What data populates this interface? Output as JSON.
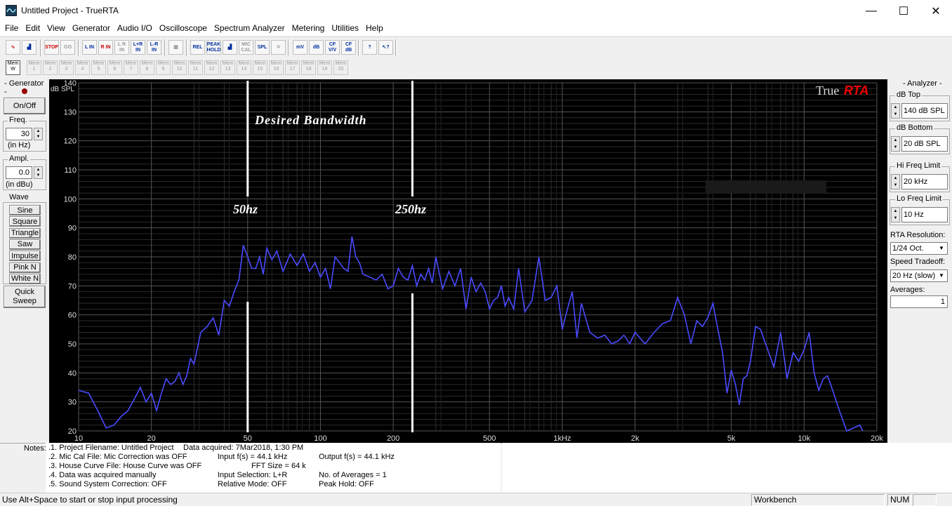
{
  "window": {
    "title": "Untitled Project - TrueRTA",
    "minimize_glyph": "—",
    "maximize_glyph": "☐",
    "close_glyph": "✕"
  },
  "menu": [
    "File",
    "Edit",
    "View",
    "Generator",
    "Audio I/O",
    "Oscilloscope",
    "Spectrum Analyzer",
    "Metering",
    "Utilities",
    "Help"
  ],
  "toolbar": {
    "buttons": [
      {
        "name": "sine-wave-icon",
        "label": "∿",
        "cls": "red"
      },
      {
        "name": "spectrum-bars-icon",
        "label": "▟",
        "cls": "blue"
      },
      {
        "name": "stop-icon",
        "label": "STOP",
        "cls": "red"
      },
      {
        "name": "go-icon",
        "label": "GO",
        "cls": "grey"
      },
      {
        "name": "left-in-button",
        "label": "L IN",
        "cls": "blue"
      },
      {
        "name": "right-in-button",
        "label": "R IN",
        "cls": "red"
      },
      {
        "name": "l-r-in-button",
        "label": "L R IN",
        "cls": "grey"
      },
      {
        "name": "l-plus-r-in-button",
        "label": "L+R IN",
        "cls": "blue"
      },
      {
        "name": "l-minus-r-in-button",
        "label": "L-R IN",
        "cls": "blue"
      },
      {
        "name": "grid-icon",
        "label": "▦",
        "cls": "grey"
      },
      {
        "name": "rel-button",
        "label": "REL",
        "cls": "blue"
      },
      {
        "name": "peak-hold-button",
        "label": "PEAK HOLD",
        "cls": "blue"
      },
      {
        "name": "spectrum-bar-icon",
        "label": "▟",
        "cls": "blue"
      },
      {
        "name": "mic-cal-button",
        "label": "MIC CAL",
        "cls": "grey"
      },
      {
        "name": "spl-button",
        "label": "SPL",
        "cls": "blue"
      },
      {
        "name": "cancel-x-icon",
        "label": "✕",
        "cls": "grey"
      },
      {
        "name": "mv-button",
        "label": "mV",
        "cls": "blue"
      },
      {
        "name": "db-button",
        "label": "dB",
        "cls": "blue"
      },
      {
        "name": "cf-vv-button",
        "label": "CF V/V",
        "cls": "blue"
      },
      {
        "name": "cf-db-button",
        "label": "CF dB",
        "cls": "blue"
      },
      {
        "name": "help-icon",
        "label": "?",
        "cls": "blue"
      },
      {
        "name": "context-help-icon",
        "label": "↖?",
        "cls": "blue"
      }
    ],
    "mem_prefix": "Mem",
    "mem_active_suffix": "W",
    "mem_slots": [
      "1",
      "2",
      "3",
      "4",
      "5",
      "6",
      "7",
      "8",
      "9",
      "10",
      "11",
      "12",
      "13",
      "14",
      "15",
      "16",
      "17",
      "18",
      "19",
      "20"
    ]
  },
  "generator": {
    "title": "- Generator -",
    "on_off": "On/Off",
    "freq_label": "Freq.",
    "freq_value": "30",
    "freq_unit": "(in Hz)",
    "ampl_label": "Ampl.",
    "ampl_value": "0.0",
    "ampl_unit": "(in dBu)",
    "wave_label": "Wave",
    "waves": [
      "Sine",
      "Square",
      "Triangle",
      "Saw",
      "Impulse",
      "Pink N",
      "White N"
    ],
    "quick_sweep_1": "Quick",
    "quick_sweep_2": "Sweep"
  },
  "analyzer": {
    "title": "- Analyzer -",
    "db_top_label": "dB Top",
    "db_top_value": "140 dB SPL",
    "db_bottom_label": "dB Bottom",
    "db_bottom_value": "20 dB SPL",
    "hi_freq_label": "Hi Freq Limit",
    "hi_freq_value": "20 kHz",
    "lo_freq_label": "Lo Freq Limit",
    "lo_freq_value": "10 Hz",
    "rta_res_label": "RTA Resolution:",
    "rta_res_value": "1/24 Oct.",
    "speed_label": "Speed Tradeoff:",
    "speed_value": "20 Hz (slow)",
    "averages_label": "Averages:",
    "averages_value": "1"
  },
  "graph": {
    "ylabel": "dB SPL",
    "logo_true": "True",
    "logo_rta": "RTA",
    "annotation_title": "Desired Bandwidth",
    "marker_50": "50hz",
    "marker_250": "250hz",
    "y_ticks": [
      "140",
      "130",
      "120",
      "110",
      "100",
      "90",
      "80",
      "70",
      "60",
      "50",
      "40",
      "30",
      "20"
    ],
    "x_ticks": [
      {
        "f": 10,
        "label": "10"
      },
      {
        "f": 20,
        "label": "20"
      },
      {
        "f": 50,
        "label": "50"
      },
      {
        "f": 100,
        "label": "100"
      },
      {
        "f": 200,
        "label": "200"
      },
      {
        "f": 500,
        "label": "500"
      },
      {
        "f": 1000,
        "label": "1kHz"
      },
      {
        "f": 2000,
        "label": "2k"
      },
      {
        "f": 5000,
        "label": "5k"
      },
      {
        "f": 10000,
        "label": "10k"
      },
      {
        "f": 20000,
        "label": "20k"
      }
    ],
    "line_color": "#4a4aff",
    "marker_freqs": [
      50,
      240
    ]
  },
  "chart_data": {
    "type": "line",
    "title": "",
    "xlabel": "",
    "ylabel": "dB SPL",
    "x_scale": "log",
    "xlim": [
      10,
      20000
    ],
    "ylim": [
      20,
      140
    ],
    "series": [
      {
        "x": [
          10,
          11,
          12,
          13,
          14,
          15,
          16,
          17,
          18,
          19,
          20,
          21,
          22,
          23,
          24,
          25,
          26,
          27,
          28,
          29,
          30,
          32,
          34,
          36,
          38,
          40,
          42,
          44,
          46,
          48,
          50,
          52,
          54,
          56,
          58,
          60,
          63,
          66,
          70,
          75,
          80,
          85,
          90,
          95,
          100,
          105,
          110,
          115,
          120,
          125,
          130,
          135,
          140,
          145,
          150,
          160,
          170,
          180,
          190,
          200,
          210,
          220,
          230,
          240,
          250,
          260,
          270,
          280,
          290,
          300,
          320,
          340,
          360,
          380,
          400,
          420,
          440,
          460,
          480,
          500,
          520,
          540,
          560,
          580,
          600,
          630,
          660,
          700,
          750,
          800,
          850,
          900,
          950,
          1000,
          1050,
          1100,
          1150,
          1200,
          1300,
          1400,
          1500,
          1600,
          1700,
          1800,
          1900,
          2000,
          2200,
          2400,
          2600,
          2800,
          3000,
          3200,
          3400,
          3600,
          3800,
          4000,
          4200,
          4400,
          4600,
          4800,
          5000,
          5200,
          5400,
          5600,
          5800,
          6000,
          6300,
          6600,
          7000,
          7500,
          8000,
          8500,
          9000,
          9500,
          10000,
          10500,
          11000,
          11500,
          12000,
          12500,
          13000,
          14000,
          15000,
          16000,
          17000,
          17500
        ],
        "y": [
          34,
          33,
          27,
          21,
          22,
          25,
          27,
          31,
          35,
          30,
          33,
          27,
          33,
          38,
          36,
          37,
          40,
          36,
          39,
          45,
          43,
          54,
          56,
          59,
          53,
          65,
          63,
          68,
          72,
          84,
          80,
          76,
          76,
          80,
          74,
          83,
          79,
          82,
          75,
          81,
          77,
          81,
          75,
          78,
          73,
          76,
          69,
          80,
          78,
          76,
          75,
          87,
          80,
          78,
          74,
          73,
          72,
          74,
          69,
          70,
          76,
          73,
          72,
          77,
          70,
          74,
          72,
          76,
          71,
          80,
          69,
          75,
          70,
          76,
          62,
          73,
          68,
          71,
          68,
          62,
          65,
          66,
          70,
          63,
          66,
          62,
          76,
          61,
          65,
          80,
          65,
          66,
          70,
          55,
          62,
          68,
          52,
          64,
          54,
          52,
          53,
          50,
          51,
          53,
          50,
          54,
          50,
          54,
          57,
          58,
          66,
          60,
          50,
          58,
          56,
          59,
          64,
          55,
          47,
          33,
          41,
          36,
          29,
          38,
          39,
          44,
          56,
          55,
          49,
          42,
          54,
          38,
          47,
          44,
          48,
          54,
          40,
          34,
          38,
          39,
          35,
          27,
          20,
          21,
          22,
          20
        ]
      }
    ]
  },
  "notes": {
    "label": "Notes:",
    "lines_left": [
      ".1. Project Filename: Untitled Project",
      ".2. Mic Cal File: Mic Correction was OFF",
      ".3. House Curve File: House Curve was OFF",
      ".4. Data was acquired manually",
      ".5. Sound System Correction: OFF"
    ],
    "data_acquired": "Data acquired: 7Mar2018, 1:30 PM",
    "input_fs": "Input f(s) = 44.1 kHz",
    "fft_size": "FFT Size = 64 k",
    "input_selection": "Input Selection: L+R",
    "relative_mode": "Relative Mode:  OFF",
    "output_fs": "Output f(s) = 44.1 kHz",
    "num_averages": "No. of Averages = 1",
    "peak_hold": "Peak Hold: OFF"
  },
  "status": {
    "hint": "Use Alt+Space to start or stop input processing",
    "workbench": "Workbench",
    "num": "NUM"
  }
}
